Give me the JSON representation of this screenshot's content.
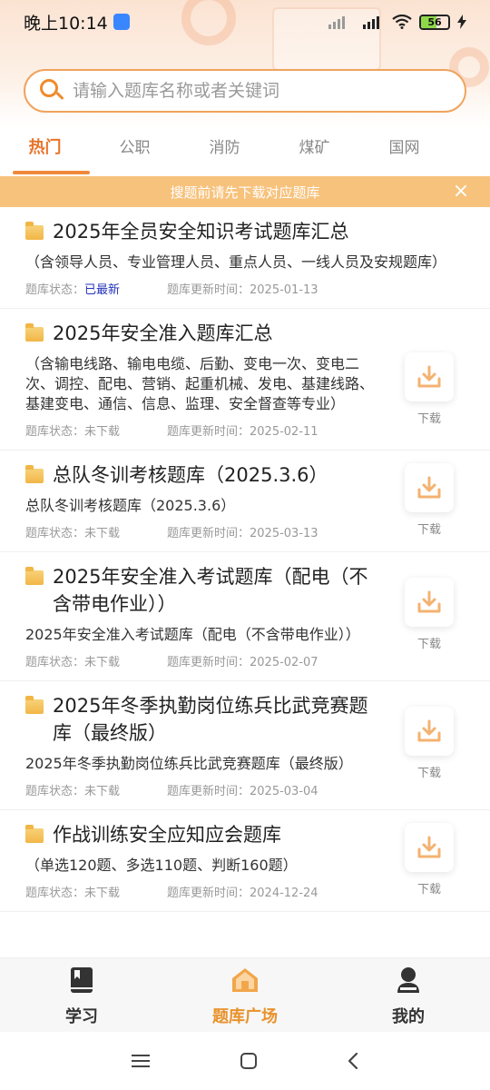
{
  "status": {
    "time": "晚上10:14",
    "battery": "56",
    "battery_level": 0.56
  },
  "search": {
    "placeholder": "请输入题库名称或者关键词"
  },
  "tabs": [
    {
      "label": "热门"
    },
    {
      "label": "公职"
    },
    {
      "label": "消防"
    },
    {
      "label": "煤矿"
    },
    {
      "label": "国网"
    }
  ],
  "notice": {
    "text": "搜题前请先下载对应题库",
    "close": "×"
  },
  "meta_labels": {
    "status": "题库状态：",
    "updated": "题库更新时间："
  },
  "download_label": "下载",
  "items": [
    {
      "title": "2025年全员安全知识考试题库汇总",
      "desc": "（含领导人员、专业管理人员、重点人员、一线人员及安规题库）",
      "status": "已最新",
      "date": "2025-01-13"
    },
    {
      "title": "2025年安全准入题库汇总",
      "desc": "（含输电线路、输电电缆、后勤、变电一次、变电二次、调控、配电、营销、起重机械、发电、基建线路、基建变电、通信、信息、监理、安全督查等专业）",
      "status": "未下载",
      "date": "2025-02-11"
    },
    {
      "title": "总队冬训考核题库（2025.3.6）",
      "desc": "总队冬训考核题库（2025.3.6）",
      "status": "未下载",
      "date": "2025-03-13"
    },
    {
      "title": "2025年安全准入考试题库（配电（不含带电作业））",
      "desc": "2025年安全准入考试题库（配电（不含带电作业））",
      "status": "未下载",
      "date": "2025-02-07"
    },
    {
      "title": "2025年冬季执勤岗位练兵比武竞赛题库（最终版）",
      "desc": "2025年冬季执勤岗位练兵比武竞赛题库（最终版）",
      "status": "未下载",
      "date": "2025-03-04"
    },
    {
      "title": "作战训练安全应知应会题库",
      "desc": "（单选120题、多选110题、判断160题）",
      "status": "未下载",
      "date": "2024-12-24"
    }
  ],
  "bottom_nav": [
    {
      "label": "学习"
    },
    {
      "label": "题库广场"
    },
    {
      "label": "我的"
    }
  ],
  "colors": {
    "accent": "#e8742b",
    "notice": "#f7c27c",
    "new_status": "#2433b8"
  }
}
